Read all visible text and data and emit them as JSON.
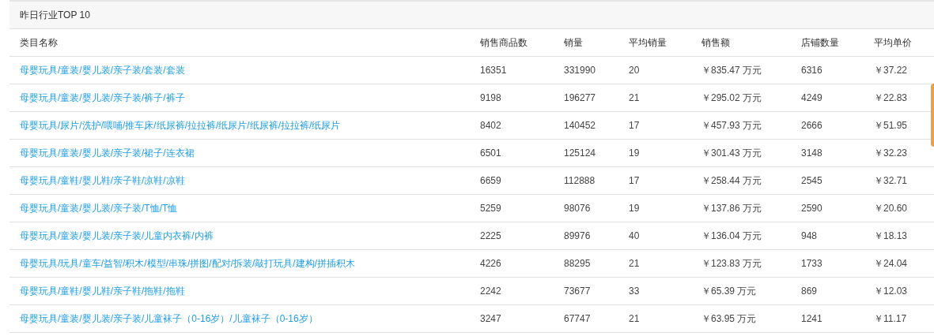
{
  "panel": {
    "title": "昨日行业TOP 10"
  },
  "table": {
    "columns": [
      "类目名称",
      "销售商品数",
      "销量",
      "平均销量",
      "销售额",
      "店铺数量",
      "平均单价"
    ],
    "rows": [
      [
        "母婴玩具/童装/婴儿装/亲子装/套装/套装",
        "16351",
        "331990",
        "20",
        "￥835.47 万元",
        "6316",
        "￥37.22"
      ],
      [
        "母婴玩具/童装/婴儿装/亲子装/裤子/裤子",
        "9198",
        "196277",
        "21",
        "￥295.02 万元",
        "4249",
        "￥22.83"
      ],
      [
        "母婴玩具/尿片/洗护/喂哺/推车床/纸尿裤/拉拉裤/纸尿片/纸尿裤/拉拉裤/纸尿片",
        "8402",
        "140452",
        "17",
        "￥457.93 万元",
        "2666",
        "￥51.95"
      ],
      [
        "母婴玩具/童装/婴儿装/亲子装/裙子/连衣裙",
        "6501",
        "125124",
        "19",
        "￥301.43 万元",
        "3148",
        "￥32.23"
      ],
      [
        "母婴玩具/童鞋/婴儿鞋/亲子鞋/凉鞋/凉鞋",
        "6659",
        "112888",
        "17",
        "￥258.44 万元",
        "2545",
        "￥32.71"
      ],
      [
        "母婴玩具/童装/婴儿装/亲子装/T恤/T恤",
        "5259",
        "98076",
        "19",
        "￥137.86 万元",
        "2590",
        "￥20.60"
      ],
      [
        "母婴玩具/童装/婴儿装/亲子装/儿童内衣裤/内裤",
        "2225",
        "89976",
        "40",
        "￥136.04 万元",
        "948",
        "￥18.13"
      ],
      [
        "母婴玩具/玩具/童车/益智/积木/模型/串珠/拼图/配对/拆装/敲打玩具/建构/拼插积木",
        "4226",
        "88295",
        "21",
        "￥123.83 万元",
        "1733",
        "￥24.04"
      ],
      [
        "母婴玩具/童鞋/婴儿鞋/亲子鞋/拖鞋/拖鞋",
        "2242",
        "73677",
        "33",
        "￥65.39 万元",
        "869",
        "￥12.03"
      ],
      [
        "母婴玩具/童装/婴儿装/亲子装/儿童袜子（0-16岁）/儿童袜子（0-16岁）",
        "3247",
        "67747",
        "21",
        "￥63.95 万元",
        "1241",
        "￥11.17"
      ]
    ]
  }
}
